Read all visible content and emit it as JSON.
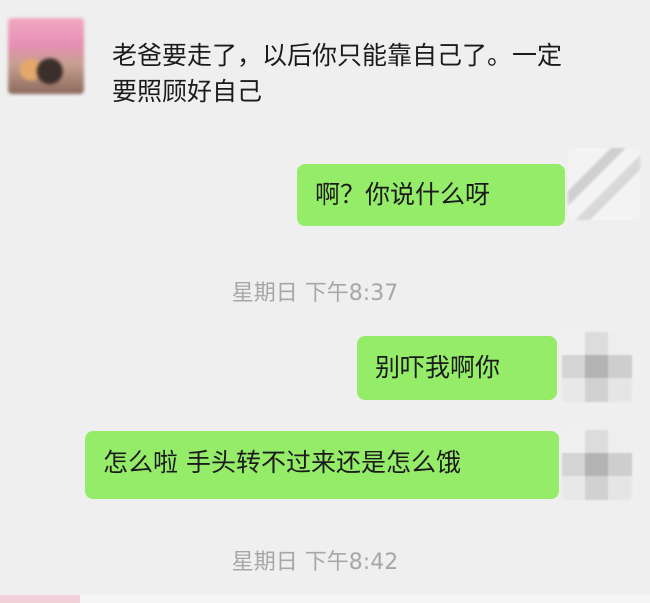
{
  "messages": {
    "incoming_text": "老爸要走了，以后你只能靠自己了。一定要照顾好自己",
    "outgoing_1": "啊？你说什么呀",
    "outgoing_2": "别吓我啊你",
    "outgoing_3": "怎么啦 手头转不过来还是怎么饿"
  },
  "timestamps": {
    "t1": "星期日 下午8:37",
    "t2": "星期日 下午8:42"
  },
  "colors": {
    "outgoing_bubble": "#95ec69",
    "background": "#efefef",
    "timestamp": "#a7a7a7"
  }
}
